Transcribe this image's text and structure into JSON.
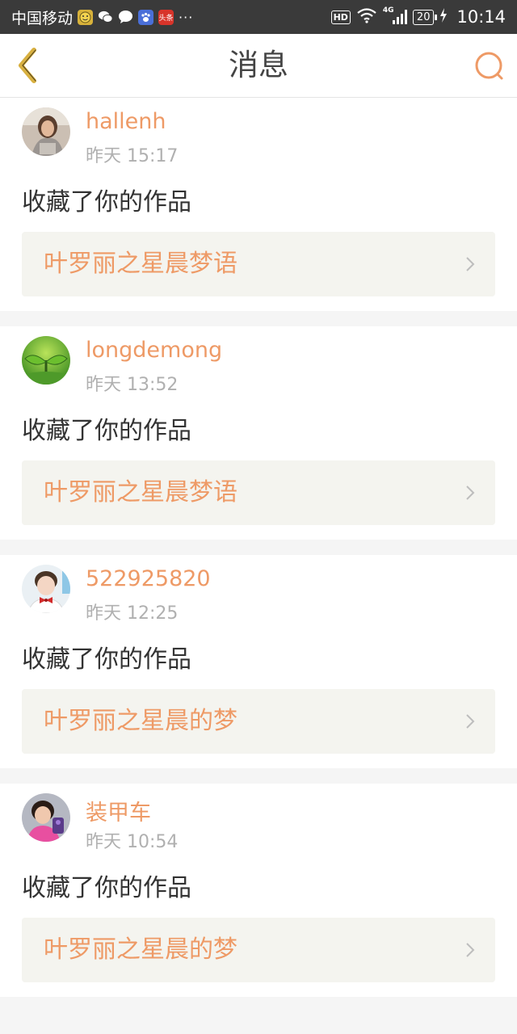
{
  "status_bar": {
    "carrier": "中国移动",
    "more": "···",
    "hd": "HD",
    "network": "4G",
    "battery": "20",
    "time": "10:14",
    "app_icons": [
      "emoji-app-icon",
      "wechat-icon",
      "chat-bubble-icon",
      "baidu-paw-icon",
      "toutiao-icon"
    ]
  },
  "header": {
    "title": "消息",
    "back_icon": "chevron-left-icon",
    "search_icon": "search-icon",
    "accent_color": "#ee9a66"
  },
  "messages": [
    {
      "username": "hallenh",
      "time": "昨天 15:17",
      "action": "收藏了你的作品",
      "work_title": "叶罗丽之星晨梦语"
    },
    {
      "username": "longdemong",
      "time": "昨天 13:52",
      "action": "收藏了你的作品",
      "work_title": "叶罗丽之星晨梦语"
    },
    {
      "username": "522925820",
      "time": "昨天 12:25",
      "action": "收藏了你的作品",
      "work_title": "叶罗丽之星晨的梦"
    },
    {
      "username": "装甲车",
      "time": "昨天 10:54",
      "action": "收藏了你的作品",
      "work_title": "叶罗丽之星晨的梦"
    }
  ],
  "toutiao_label": "头条"
}
